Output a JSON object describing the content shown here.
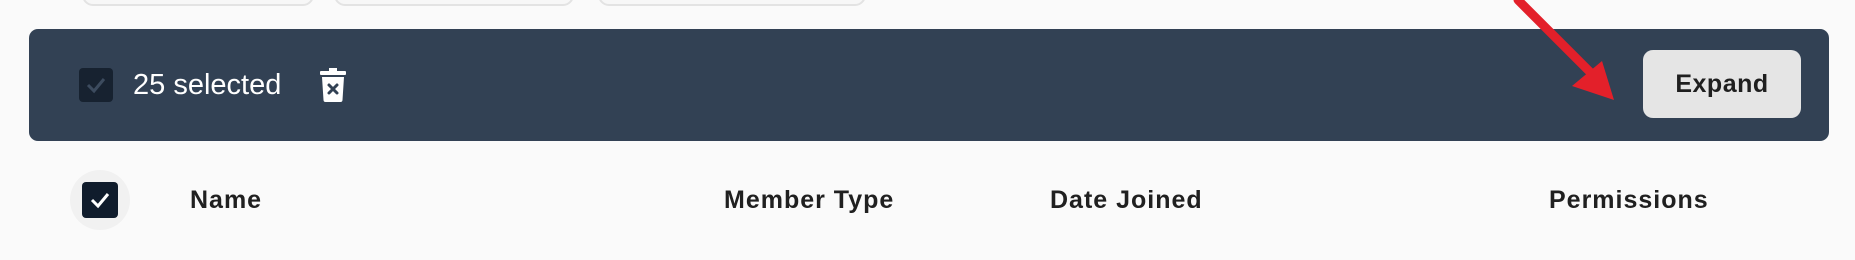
{
  "selection_bar": {
    "selected_label": "25 selected",
    "expand_label": "Expand"
  },
  "table": {
    "columns": [
      "Name",
      "Member Type",
      "Date Joined",
      "Permissions"
    ]
  },
  "icons": {
    "bulk_check": "checkbox-checked-icon",
    "delete": "trash-x-icon",
    "header_check": "checkbox-checked-icon"
  },
  "colors": {
    "bar_background": "#324154",
    "checkbox_fill": "#101c2c",
    "expand_button": "#e5e5e5",
    "annotation_arrow": "#e3202a"
  }
}
